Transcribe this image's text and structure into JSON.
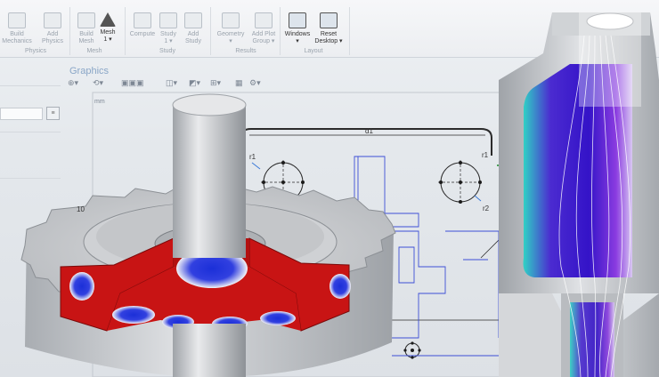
{
  "ribbon": {
    "buttons": [
      {
        "label": "Build\nMechanics",
        "group": "physics",
        "active": false
      },
      {
        "label": "Add\nPhysics",
        "group": "physics",
        "active": false
      },
      {
        "label": "Build\nMesh",
        "group": "mesh",
        "active": false
      },
      {
        "label": "Mesh\n1 ▾",
        "group": "mesh",
        "active": true
      },
      {
        "label": "Compute",
        "group": "study",
        "active": false
      },
      {
        "label": "Study\n1 ▾",
        "group": "study",
        "active": false
      },
      {
        "label": "Add\nStudy",
        "group": "study",
        "active": false
      },
      {
        "label": "Geometry\n▾",
        "group": "results",
        "active": false
      },
      {
        "label": "Add Plot\nGroup ▾",
        "group": "results",
        "active": false
      },
      {
        "label": "Windows\n▾",
        "group": "layout",
        "active": true
      },
      {
        "label": "Reset\nDesktop ▾",
        "group": "layout",
        "active": true
      }
    ],
    "groups": {
      "physics": "Physics",
      "mesh": "Mesh",
      "study": "Study",
      "results": "Results",
      "layout": "Layout"
    }
  },
  "graphics": {
    "title": "Graphics",
    "units": "mm"
  },
  "sketch": {
    "dimension_top": "d1",
    "radius_left": "r1",
    "radius_right": "r1",
    "radius_lower": "r2",
    "tick_label": "10"
  },
  "colors": {
    "accent_blue": "#1a2fd0",
    "stress_red": "#c81414",
    "metal_gray": "#c9cbce",
    "flow_purple": "#5a22c8",
    "flow_cyan": "#22c8d8"
  },
  "icons": [
    "zoom-icon",
    "rotate-icon",
    "view-icon",
    "camera-icon",
    "grid-icon",
    "settings-icon"
  ]
}
